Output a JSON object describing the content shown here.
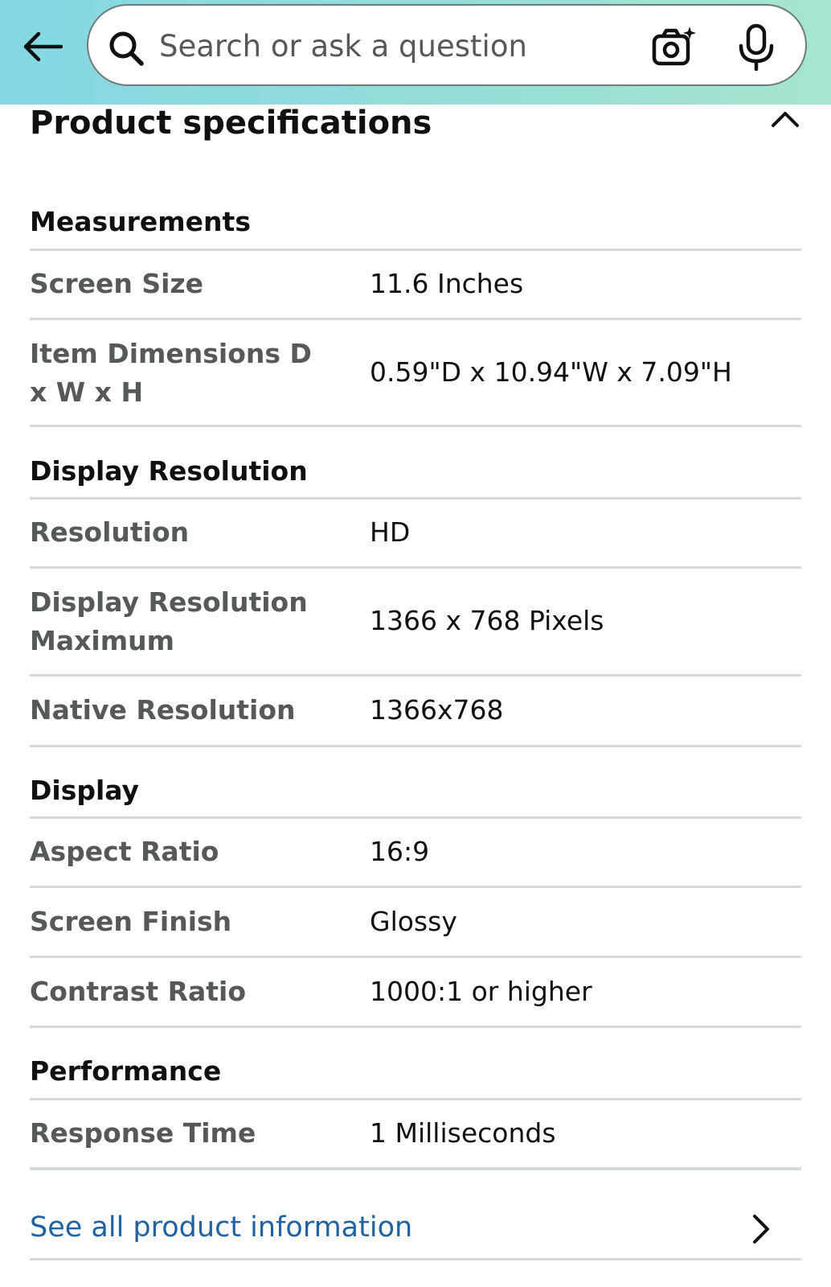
{
  "search": {
    "placeholder": "Search or ask a question"
  },
  "icons": {
    "back": "back-arrow-icon",
    "search": "search-icon",
    "camera": "camera-icon",
    "mic": "microphone-icon",
    "collapse": "chevron-up-icon",
    "see_all": "chevron-right-icon"
  },
  "colors": {
    "header_gradient_start": "#84d8e3",
    "header_gradient_end": "#a6e6ce",
    "link": "#2162a1",
    "label": "#565959",
    "text": "#0f1111",
    "divider": "#d5d9d9"
  },
  "specs": {
    "title": "Product specifications",
    "sections": [
      {
        "title": "Measurements",
        "rows": [
          {
            "label": "Screen Size",
            "value": "11.6 Inches"
          },
          {
            "label": "Item Dimensions D x W x H",
            "value": "0.59\"D x 10.94\"W x 7.09\"H"
          }
        ]
      },
      {
        "title": "Display Resolution",
        "rows": [
          {
            "label": "Resolution",
            "value": "HD"
          },
          {
            "label": "Display Resolution Maximum",
            "value": "1366 x 768 Pixels"
          },
          {
            "label": "Native Resolution",
            "value": "1366x768"
          }
        ]
      },
      {
        "title": "Display",
        "rows": [
          {
            "label": "Aspect Ratio",
            "value": "16:9"
          },
          {
            "label": "Screen Finish",
            "value": "Glossy"
          },
          {
            "label": "Contrast Ratio",
            "value": "1000:1 or higher"
          }
        ]
      },
      {
        "title": "Performance",
        "rows": [
          {
            "label": "Response Time",
            "value": "1 Milliseconds"
          }
        ]
      }
    ]
  },
  "footer": {
    "see_all_label": "See all product information"
  }
}
